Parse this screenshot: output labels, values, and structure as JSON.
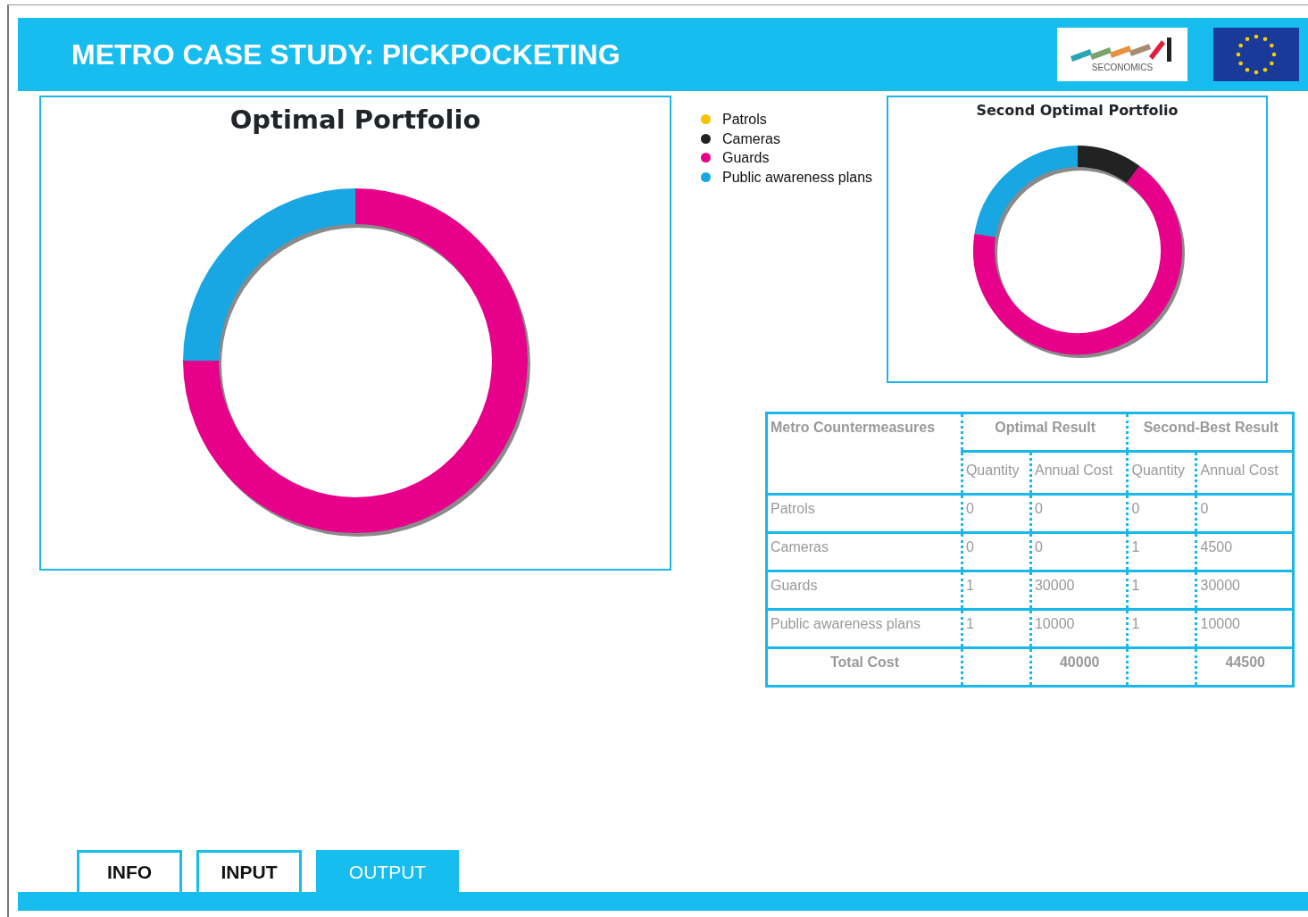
{
  "header": {
    "title": "METRO CASE STUDY: PICKPOCKETING",
    "logo_text": "SECONOMICS"
  },
  "legend": [
    {
      "label": "Patrols",
      "color": "#f9c000"
    },
    {
      "label": "Cameras",
      "color": "#222222"
    },
    {
      "label": "Guards",
      "color": "#e6008a"
    },
    {
      "label": "Public awareness plans",
      "color": "#18a7e2"
    }
  ],
  "charts": [
    {
      "title": "Optimal Portfolio"
    },
    {
      "title": "Second Optimal Portfolio"
    }
  ],
  "table": {
    "row_header": "Metro Countermeasures",
    "groups": [
      {
        "label": "Optimal Result",
        "subcolumns": [
          "Quantity",
          "Annual Cost"
        ]
      },
      {
        "label": "Second-Best Result",
        "subcolumns": [
          "Quantity",
          "Annual Cost"
        ]
      }
    ],
    "rows": [
      {
        "cells": [
          "Patrols",
          "0",
          "0",
          "0",
          "0"
        ]
      },
      {
        "cells": [
          "Cameras",
          "0",
          "0",
          "1",
          "4500"
        ]
      },
      {
        "cells": [
          "Guards",
          "1",
          "30000",
          "1",
          "30000"
        ]
      },
      {
        "cells": [
          "Public awareness plans",
          "1",
          "10000",
          "1",
          "10000"
        ]
      }
    ],
    "total": {
      "label": "Total Cost",
      "optimal_cost": "40000",
      "second_cost": "44500"
    }
  },
  "tabs": [
    {
      "label": "INFO",
      "selected": false
    },
    {
      "label": "INPUT",
      "selected": false
    },
    {
      "label": "OUTPUT",
      "selected": true
    }
  ]
}
